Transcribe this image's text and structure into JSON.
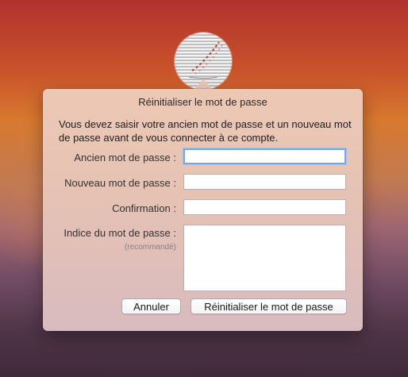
{
  "avatar": {
    "icon": "user-avatar-photo"
  },
  "dialog": {
    "title": "Réinitialiser le mot de passe",
    "message": "Vous devez saisir votre ancien mot de passe et un nouveau mot de passe avant de vous connecter à ce compte.",
    "fields": {
      "old_password": {
        "label": "Ancien mot de passe :",
        "value": ""
      },
      "new_password": {
        "label": "Nouveau mot de passe :",
        "value": ""
      },
      "confirmation": {
        "label": "Confirmation :",
        "value": ""
      },
      "hint": {
        "label": "Indice du mot de passe :",
        "sublabel": "(recommandé)",
        "value": ""
      }
    },
    "buttons": {
      "cancel": "Annuler",
      "reset": "Réinitialiser le mot de passe"
    }
  }
}
